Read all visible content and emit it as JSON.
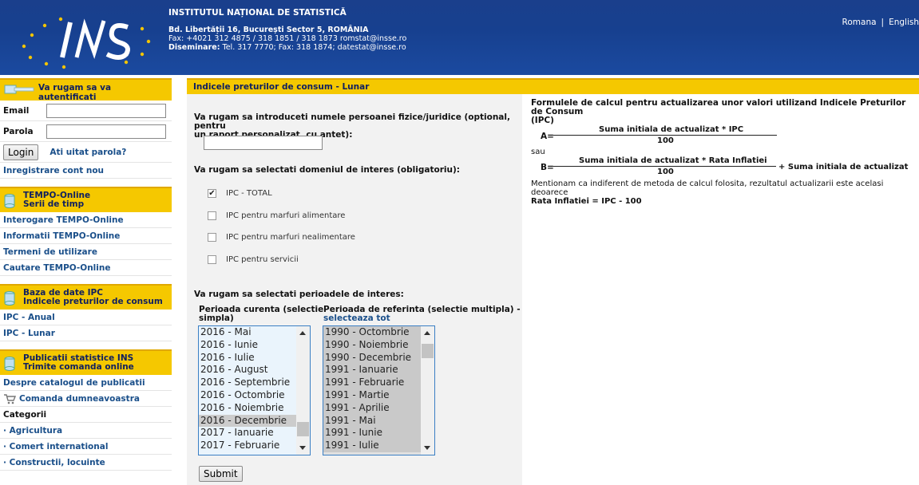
{
  "header": {
    "institution": "INSTITUTUL NAȚIONAL DE STATISTICĂ",
    "address": "Bd. Libertății 16, București Sector 5, ROMÂNIA",
    "fax_line": "Fax: +4021 312 4875 / 318 1851 / 318 1873 romstat@insse.ro",
    "dissemination_label": "Diseminare:",
    "dissemination_value": " Tel.  317 7770; Fax: 318 1874; datestat@insse.ro",
    "lang_ro": "Romana",
    "lang_sep": "|",
    "lang_en": "English"
  },
  "sidebar": {
    "login_title": "Va rugam sa va autentificati",
    "email_label": "Email",
    "password_label": "Parola",
    "login_button": "Login",
    "forgot_password": "Ati uitat parola?",
    "register": "Inregistrare cont nou",
    "tempo_title_1": "TEMPO-Online",
    "tempo_title_2": "Serii de timp",
    "tempo_links": [
      "Interogare TEMPO-Online",
      "Informatii TEMPO-Online",
      "Termeni de utilizare",
      "Cautare TEMPO-Online"
    ],
    "ipc_title_1": "Baza de date IPC",
    "ipc_title_2": "Indicele preturilor de consum",
    "ipc_links": [
      "IPC - Anual",
      "IPC - Lunar"
    ],
    "pub_title_1": "Publicatii statistice INS",
    "pub_title_2": "Trimite comanda online",
    "pub_catalog": "Despre catalogul de publicatii",
    "pub_order": "Comanda dumneavoastra",
    "categories_label": "Categorii",
    "categories": [
      "· Agricultura",
      "· Comert international",
      "· Constructii, locuinte"
    ]
  },
  "main": {
    "title": "Indicele preturilor de consum - Lunar",
    "q_name_1": "Va rugam sa introduceti numele persoanei fizice/juridice (optional, pentru",
    "q_name_2": "un raport personalizat, cu antet):",
    "q_domain": "Va rugam sa selectati domeniul de interes (obligatoriu):",
    "domains": [
      {
        "label": "IPC - TOTAL",
        "checked": true
      },
      {
        "label": "IPC pentru marfuri alimentare",
        "checked": false
      },
      {
        "label": "IPC pentru marfuri nealimentare",
        "checked": false
      },
      {
        "label": "IPC pentru servicii",
        "checked": false
      }
    ],
    "q_period": "Va rugam sa selectati perioadele de interes:",
    "current_label_1": "Perioada curenta (selectie",
    "current_label_2": "simpla)",
    "reference_label_1": "Perioada de referinta (selectie multipla) -",
    "select_all": "selecteaza tot",
    "current_options": [
      "2016 - Mai",
      "2016 - Iunie",
      "2016 - Iulie",
      "2016 - August",
      "2016 - Septembrie",
      "2016 - Octombrie",
      "2016 - Noiembrie",
      "2016 - Decembrie",
      "2017 - Ianuarie",
      "2017 - Februarie"
    ],
    "current_selected": "2016 - Decembrie",
    "reference_options": [
      "1990 - Octombrie",
      "1990 - Noiembrie",
      "1990 - Decembrie",
      "1991 - Ianuarie",
      "1991 - Februarie",
      "1991 - Martie",
      "1991 - Aprilie",
      "1991 - Mai",
      "1991 - Iunie",
      "1991 - Iulie"
    ],
    "submit": "Submit"
  },
  "formulas": {
    "title_1": "Formulele de calcul pentru actualizarea unor valori utilizand Indicele Preturilor de Consum",
    "title_2": "(IPC)",
    "a_label": "A=",
    "a_num": "Suma initiala de actualizat * IPC",
    "a_den": "100",
    "or": "sau",
    "b_label": "B=",
    "b_num": "Suma initiala de actualizat * Rata Inflatiei",
    "b_den": "100",
    "b_plus": "+ Suma initiala de actualizat",
    "note": "Mentionam ca indiferent de metoda de calcul folosita, rezultatul actualizarii este acelasi deoarece",
    "rate": "Rata Inflatiei = IPC - 100"
  },
  "colors": {
    "header_blue": "#1a3f8c",
    "bar_yellow": "#f5c800",
    "link_blue": "#1a4f8a"
  }
}
